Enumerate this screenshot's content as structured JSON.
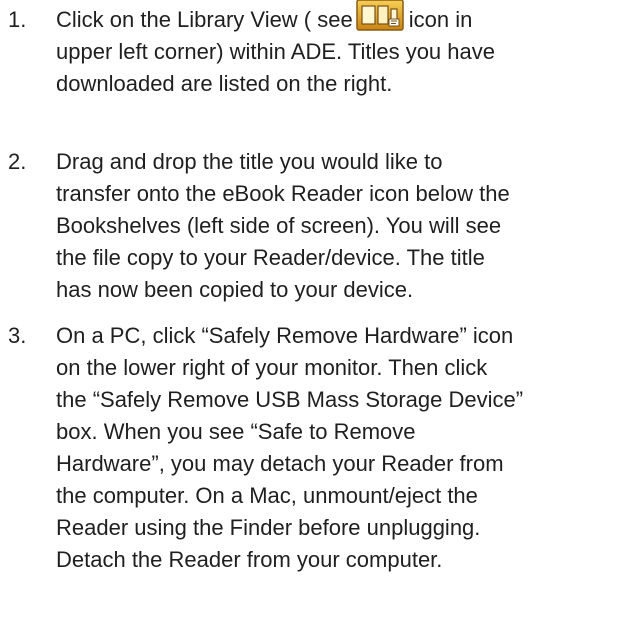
{
  "steps": [
    {
      "number": "1.",
      "line1_before_icon": "Click on the Library View ( see",
      "icon": "library-view-icon",
      "line1_after_icon": "icon in",
      "lines": [
        "upper left corner) within ADE.  Titles you have",
        "downloaded are listed on the right."
      ]
    },
    {
      "number": "2.",
      "lines": [
        "Drag and drop the title you would like to",
        "transfer onto the eBook Reader icon below the",
        "Bookshelves (left side of screen). You will see",
        "the file copy to your Reader/device. The title",
        "has now been copied to your device."
      ]
    },
    {
      "number": "3.",
      "lines": [
        "On a PC, click “Safely Remove Hardware” icon",
        "on the lower right of your monitor.  Then click",
        "the “Safely Remove USB Mass Storage Device”",
        "box. When you see “Safe to Remove",
        "Hardware”, you may detach your Reader from",
        "the computer.  On a Mac, unmount/eject the",
        "Reader using the Finder before unplugging.",
        "Detach the Reader from your computer."
      ]
    }
  ],
  "colors": {
    "text": "#1f1f1f",
    "icon_gold": "#e2a42a",
    "icon_dark": "#7a5114"
  }
}
